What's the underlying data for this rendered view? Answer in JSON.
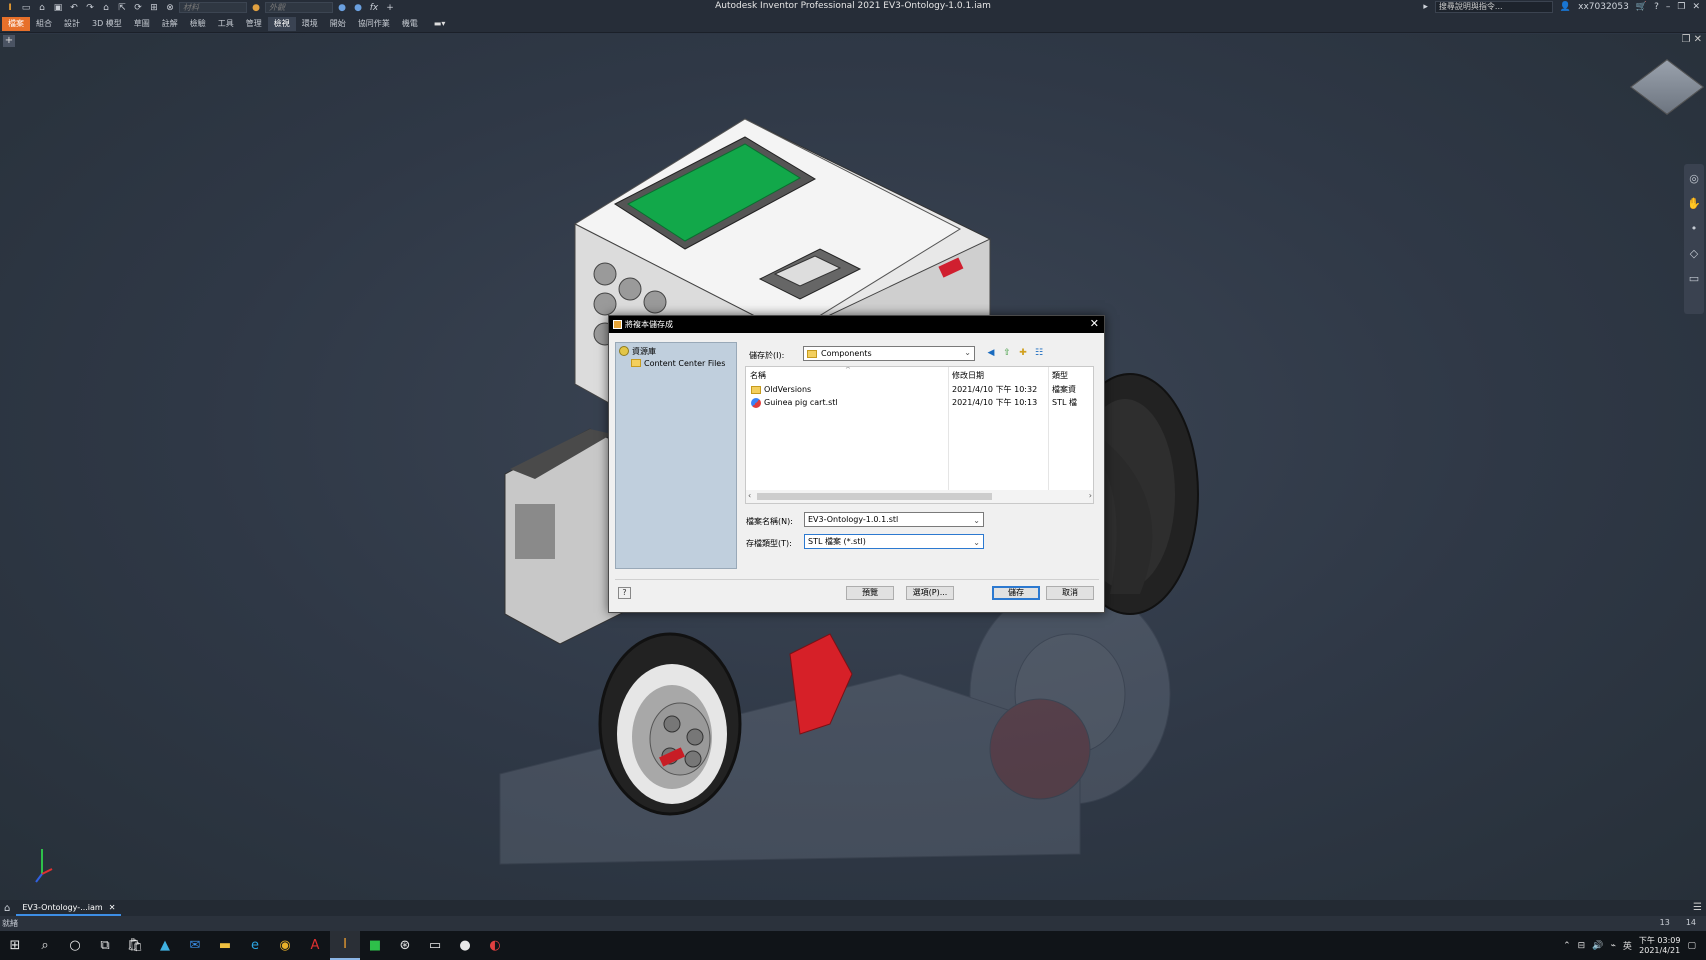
{
  "titlebar": {
    "app_title": "Autodesk Inventor Professional 2021    EV3-Ontology-1.0.1.iam",
    "qat_dropdown1": "材料",
    "qat_dropdown2": "外觀",
    "help_search_placeholder": "搜尋說明與指令...",
    "user": "xx7032053"
  },
  "ribbon_tabs": [
    "檔案",
    "組合",
    "設計",
    "3D 模型",
    "草圖",
    "註解",
    "檢驗",
    "工具",
    "管理",
    "檢視",
    "環境",
    "開始",
    "協同作業",
    "機電"
  ],
  "active_tab": "檢視",
  "dialog": {
    "title": "將複本儲存成",
    "tree": {
      "root": "資源庫",
      "child": "Content Center Files"
    },
    "save_in_label": "儲存於(I):",
    "save_in_value": "Components",
    "columns": {
      "name": "名稱",
      "modified": "修改日期",
      "type": "類型"
    },
    "files": [
      {
        "name": "OldVersions",
        "modified": "2021/4/10 下午 10:32",
        "type": "檔案資",
        "kind": "folder"
      },
      {
        "name": "Guinea pig cart.stl",
        "modified": "2021/4/10 下午 10:13",
        "type": "STL 檔",
        "kind": "stl"
      }
    ],
    "filename_label": "檔案名稱(N):",
    "filename_value": "EV3-Ontology-1.0.1.stl",
    "filetype_label": "存檔類型(T):",
    "filetype_value": "STL 檔案 (*.stl)",
    "buttons": {
      "preview": "預覽",
      "options": "選項(P)...",
      "save": "儲存",
      "cancel": "取消"
    }
  },
  "doc_tab": {
    "label": "EV3-Ontology-...iam"
  },
  "status": {
    "text": "就緒",
    "num1": "13",
    "num2": "14"
  },
  "clock": {
    "time": "下午 03:09",
    "date": "2021/4/21"
  },
  "colors": {
    "file_tab": "#e7702a",
    "accent": "#2c79d0",
    "lego_green": "#12a84a"
  }
}
